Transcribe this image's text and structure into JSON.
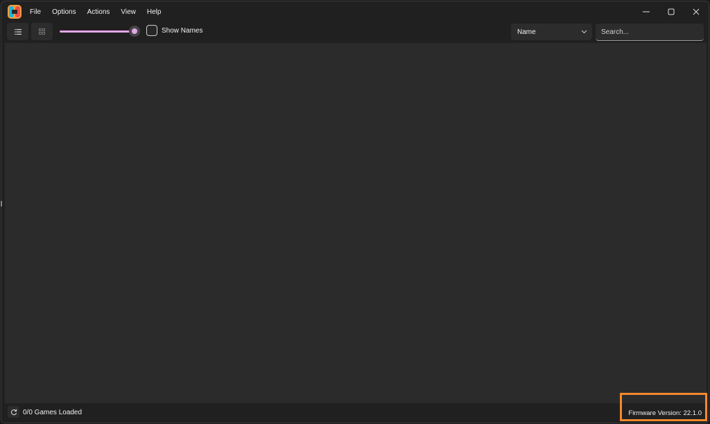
{
  "app": {
    "icon": "joycon-app-icon"
  },
  "menu": {
    "items": [
      {
        "label": "File"
      },
      {
        "label": "Options"
      },
      {
        "label": "Actions"
      },
      {
        "label": "View"
      },
      {
        "label": "Help"
      }
    ]
  },
  "window_controls": {
    "minimize_icon": "minimize-icon",
    "maximize_icon": "maximize-icon",
    "close_icon": "close-icon"
  },
  "toolbar": {
    "list_view_icon": "list-view-icon",
    "grid_view_icon": "grid-view-icon",
    "icon_size_slider_value": 1.0,
    "show_names_label": "Show Names",
    "show_names_checked": false,
    "sort_value": "Name",
    "search_placeholder": "Search..."
  },
  "status": {
    "refresh_icon": "refresh-icon",
    "games_loaded": "0/0 Games Loaded",
    "firmware_version": "Firmware Version: 22.1.0"
  },
  "colors": {
    "accent": "#e3a7e6",
    "window_bg": "#202020",
    "content_bg": "#2b2b2b",
    "highlight_box": "#f5892e"
  }
}
